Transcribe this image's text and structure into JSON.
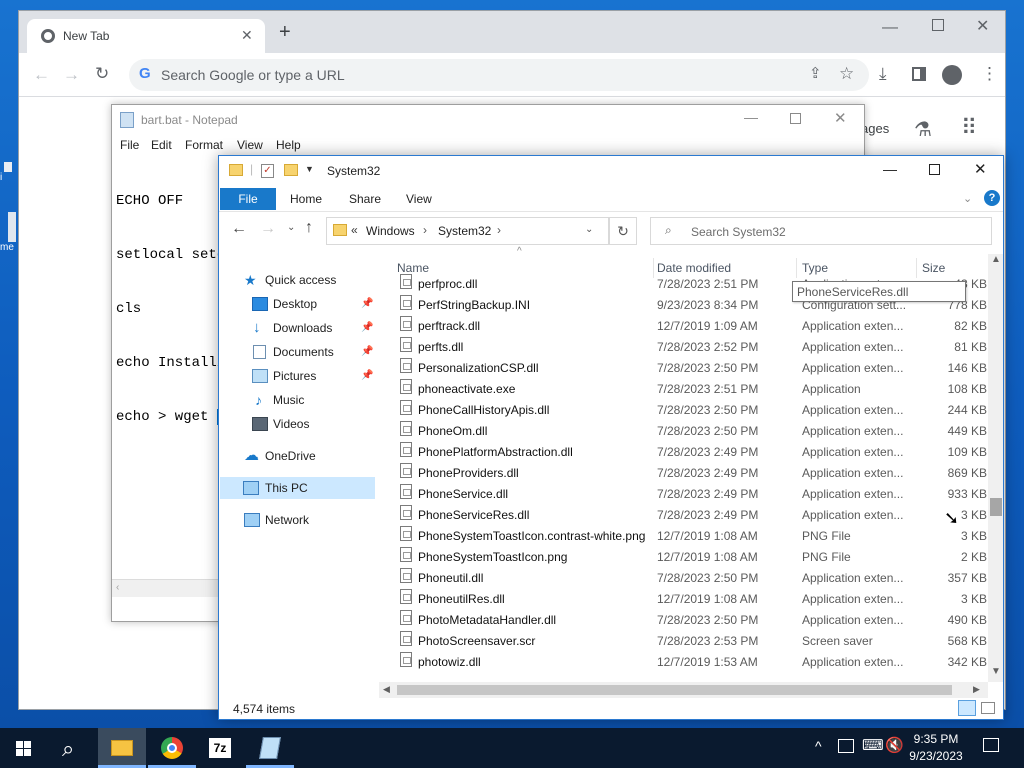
{
  "desktop": {
    "icons": [
      {
        "label": "i"
      },
      {
        "label": "me"
      }
    ]
  },
  "chrome": {
    "tab_title": "New Tab",
    "new_tab_symbol": "+",
    "omnibox_placeholder": "Search Google or type a URL",
    "page_link": "ages"
  },
  "notepad": {
    "title": "bart.bat - Notepad",
    "menu": [
      "File",
      "Edit",
      "Format",
      "View",
      "Help"
    ],
    "lines": [
      "ECHO OFF",
      "setlocal setd",
      "cls",
      "echo Installi",
      "echo > wget "
    ],
    "selection": "h"
  },
  "explorer": {
    "title": "System32",
    "ribbon_file": "File",
    "ribbon_tabs": [
      "Home",
      "Share",
      "View"
    ],
    "breadcrumb_sep": "«",
    "breadcrumb": [
      "Windows",
      "System32"
    ],
    "search_placeholder": "Search System32",
    "nav": {
      "quick_access": "Quick access",
      "desktop": "Desktop",
      "downloads": "Downloads",
      "documents": "Documents",
      "pictures": "Pictures",
      "music": "Music",
      "videos": "Videos",
      "onedrive": "OneDrive",
      "this_pc": "This PC",
      "network": "Network"
    },
    "columns": {
      "name": "Name",
      "date": "Date modified",
      "type": "Type",
      "size": "Size"
    },
    "tooltip": "PhoneServiceRes.dll",
    "rows": [
      {
        "name": "perfproc.dll",
        "date": "7/28/2023 2:51 PM",
        "type": "Application exten...",
        "size": "43 KB"
      },
      {
        "name": "PerfStringBackup.INI",
        "date": "9/23/2023 8:34 PM",
        "type": "Configuration sett...",
        "size": "778 KB"
      },
      {
        "name": "perftrack.dll",
        "date": "12/7/2019 1:09 AM",
        "type": "Application exten...",
        "size": "82 KB"
      },
      {
        "name": "perfts.dll",
        "date": "7/28/2023 2:52 PM",
        "type": "Application exten...",
        "size": "81 KB"
      },
      {
        "name": "PersonalizationCSP.dll",
        "date": "7/28/2023 2:50 PM",
        "type": "Application exten...",
        "size": "146 KB"
      },
      {
        "name": "phoneactivate.exe",
        "date": "7/28/2023 2:51 PM",
        "type": "Application",
        "size": "108 KB"
      },
      {
        "name": "PhoneCallHistoryApis.dll",
        "date": "7/28/2023 2:50 PM",
        "type": "Application exten...",
        "size": "244 KB"
      },
      {
        "name": "PhoneOm.dll",
        "date": "7/28/2023 2:50 PM",
        "type": "Application exten...",
        "size": "449 KB"
      },
      {
        "name": "PhonePlatformAbstraction.dll",
        "date": "7/28/2023 2:49 PM",
        "type": "Application exten...",
        "size": "109 KB"
      },
      {
        "name": "PhoneProviders.dll",
        "date": "7/28/2023 2:49 PM",
        "type": "Application exten...",
        "size": "869 KB"
      },
      {
        "name": "PhoneService.dll",
        "date": "7/28/2023 2:49 PM",
        "type": "Application exten...",
        "size": "933 KB"
      },
      {
        "name": "PhoneServiceRes.dll",
        "date": "7/28/2023 2:49 PM",
        "type": "Application exten...",
        "size": "3 KB"
      },
      {
        "name": "PhoneSystemToastIcon.contrast-white.png",
        "date": "12/7/2019 1:08 AM",
        "type": "PNG File",
        "size": "3 KB"
      },
      {
        "name": "PhoneSystemToastIcon.png",
        "date": "12/7/2019 1:08 AM",
        "type": "PNG File",
        "size": "2 KB"
      },
      {
        "name": "Phoneutil.dll",
        "date": "7/28/2023 2:50 PM",
        "type": "Application exten...",
        "size": "357 KB"
      },
      {
        "name": "PhoneutilRes.dll",
        "date": "12/7/2019 1:08 AM",
        "type": "Application exten...",
        "size": "3 KB"
      },
      {
        "name": "PhotoMetadataHandler.dll",
        "date": "7/28/2023 2:50 PM",
        "type": "Application exten...",
        "size": "490 KB"
      },
      {
        "name": "PhotoScreensaver.scr",
        "date": "7/28/2023 2:53 PM",
        "type": "Screen saver",
        "size": "568 KB"
      },
      {
        "name": "photowiz.dll",
        "date": "12/7/2019 1:53 AM",
        "type": "Application exten...",
        "size": "342 KB"
      }
    ],
    "status": "4,574 items"
  },
  "taskbar": {
    "time": "9:35 PM",
    "date": "9/23/2023",
    "apps": [
      "File Explorer",
      "Chrome",
      "7-Zip",
      "Notepad"
    ]
  },
  "colors": {
    "accent": "#1979ca",
    "taskbar": "#0a1a2f",
    "desktop": "#1565c0"
  }
}
